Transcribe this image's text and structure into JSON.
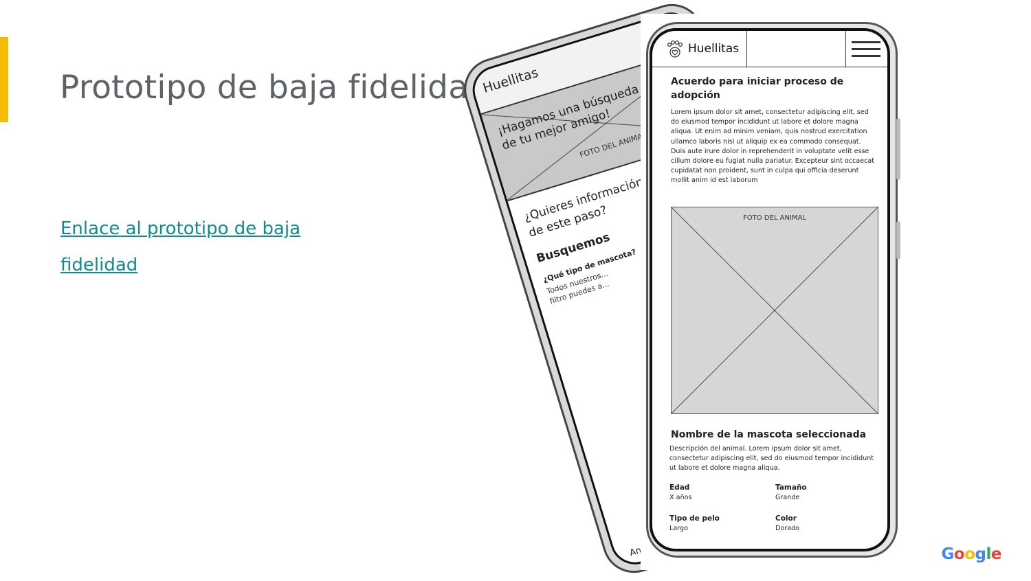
{
  "slide": {
    "title": "Prototipo de baja fidelidad",
    "link_text": "Enlace al prototipo de baja fidelidad",
    "accent_color": "#f6bb00",
    "link_color": "#0f8b93",
    "footer_logo": {
      "g1": "G",
      "o1": "o",
      "o2": "o",
      "g2": "g",
      "l": "l",
      "e": "e"
    }
  },
  "back_phone": {
    "logo": "Huellitas",
    "hero_title": "¡Hagamos una búsqueda de tu mejor amigo!",
    "hero_photo_label": "FOTO DEL ANIMAL",
    "question": "¿Quieres información de este paso?",
    "search_heading": "Busquemos",
    "pet_type_question": "¿Qué tipo de mascota?",
    "pet_type_help": "Todos nuestros... filtro puedes a...",
    "footer_text": "Animal"
  },
  "front_phone": {
    "logo": "Huellitas",
    "icons": {
      "logo": "paw-icon",
      "menu": "hamburger-menu-icon"
    },
    "heading": "Acuerdo para iniciar proceso de adopción",
    "lorem": "Lorem ipsum dolor sit amet, consectetur adipiscing elit, sed do eiusmod tempor incididunt ut labore et dolore magna aliqua. Ut enim ad minim veniam, quis nostrud exercitation ullamco laboris nisi ut aliquip ex ea commodo consequat. Duis aute irure dolor in reprehenderit in voluptate velit esse cillum dolore eu fugiat nulla pariatur. Excepteur sint occaecat cupidatat non proident, sunt in culpa qui officia deserunt mollit anim id est laborum",
    "photo_label": "FOTO DEL ANIMAL",
    "pet_name": "Nombre de la mascota seleccionada",
    "pet_description": "Descripción del animal. Lorem ipsum dolor sit amet, consectetur adipiscing elit, sed do eiusmod tempor incididunt ut labore et dolore magna aliqua.",
    "attributes": [
      {
        "label": "Edad",
        "value": "X años"
      },
      {
        "label": "Tamaño",
        "value": "Grande"
      },
      {
        "label": "Tipo de pelo",
        "value": "Largo"
      },
      {
        "label": "Color",
        "value": "Dorado"
      }
    ]
  }
}
